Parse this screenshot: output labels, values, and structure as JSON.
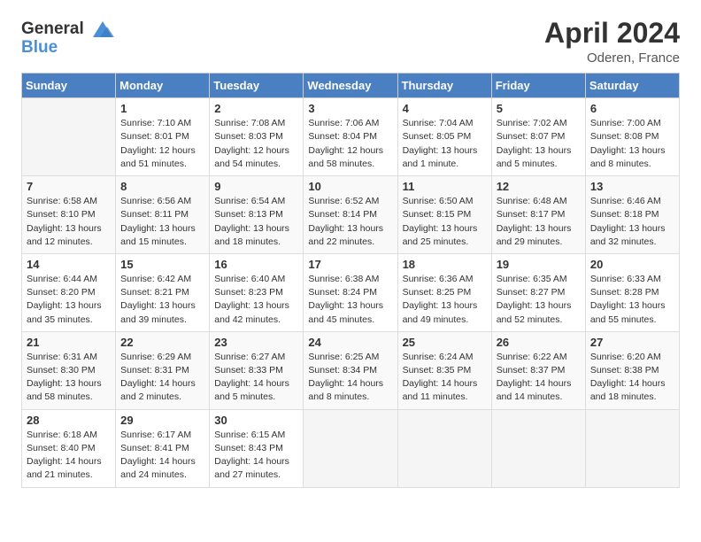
{
  "header": {
    "logo_line1": "General",
    "logo_line2": "Blue",
    "title": "April 2024",
    "subtitle": "Oderen, France"
  },
  "days_of_week": [
    "Sunday",
    "Monday",
    "Tuesday",
    "Wednesday",
    "Thursday",
    "Friday",
    "Saturday"
  ],
  "weeks": [
    [
      {
        "num": "",
        "info": ""
      },
      {
        "num": "1",
        "info": "Sunrise: 7:10 AM\nSunset: 8:01 PM\nDaylight: 12 hours\nand 51 minutes."
      },
      {
        "num": "2",
        "info": "Sunrise: 7:08 AM\nSunset: 8:03 PM\nDaylight: 12 hours\nand 54 minutes."
      },
      {
        "num": "3",
        "info": "Sunrise: 7:06 AM\nSunset: 8:04 PM\nDaylight: 12 hours\nand 58 minutes."
      },
      {
        "num": "4",
        "info": "Sunrise: 7:04 AM\nSunset: 8:05 PM\nDaylight: 13 hours\nand 1 minute."
      },
      {
        "num": "5",
        "info": "Sunrise: 7:02 AM\nSunset: 8:07 PM\nDaylight: 13 hours\nand 5 minutes."
      },
      {
        "num": "6",
        "info": "Sunrise: 7:00 AM\nSunset: 8:08 PM\nDaylight: 13 hours\nand 8 minutes."
      }
    ],
    [
      {
        "num": "7",
        "info": "Sunrise: 6:58 AM\nSunset: 8:10 PM\nDaylight: 13 hours\nand 12 minutes."
      },
      {
        "num": "8",
        "info": "Sunrise: 6:56 AM\nSunset: 8:11 PM\nDaylight: 13 hours\nand 15 minutes."
      },
      {
        "num": "9",
        "info": "Sunrise: 6:54 AM\nSunset: 8:13 PM\nDaylight: 13 hours\nand 18 minutes."
      },
      {
        "num": "10",
        "info": "Sunrise: 6:52 AM\nSunset: 8:14 PM\nDaylight: 13 hours\nand 22 minutes."
      },
      {
        "num": "11",
        "info": "Sunrise: 6:50 AM\nSunset: 8:15 PM\nDaylight: 13 hours\nand 25 minutes."
      },
      {
        "num": "12",
        "info": "Sunrise: 6:48 AM\nSunset: 8:17 PM\nDaylight: 13 hours\nand 29 minutes."
      },
      {
        "num": "13",
        "info": "Sunrise: 6:46 AM\nSunset: 8:18 PM\nDaylight: 13 hours\nand 32 minutes."
      }
    ],
    [
      {
        "num": "14",
        "info": "Sunrise: 6:44 AM\nSunset: 8:20 PM\nDaylight: 13 hours\nand 35 minutes."
      },
      {
        "num": "15",
        "info": "Sunrise: 6:42 AM\nSunset: 8:21 PM\nDaylight: 13 hours\nand 39 minutes."
      },
      {
        "num": "16",
        "info": "Sunrise: 6:40 AM\nSunset: 8:23 PM\nDaylight: 13 hours\nand 42 minutes."
      },
      {
        "num": "17",
        "info": "Sunrise: 6:38 AM\nSunset: 8:24 PM\nDaylight: 13 hours\nand 45 minutes."
      },
      {
        "num": "18",
        "info": "Sunrise: 6:36 AM\nSunset: 8:25 PM\nDaylight: 13 hours\nand 49 minutes."
      },
      {
        "num": "19",
        "info": "Sunrise: 6:35 AM\nSunset: 8:27 PM\nDaylight: 13 hours\nand 52 minutes."
      },
      {
        "num": "20",
        "info": "Sunrise: 6:33 AM\nSunset: 8:28 PM\nDaylight: 13 hours\nand 55 minutes."
      }
    ],
    [
      {
        "num": "21",
        "info": "Sunrise: 6:31 AM\nSunset: 8:30 PM\nDaylight: 13 hours\nand 58 minutes."
      },
      {
        "num": "22",
        "info": "Sunrise: 6:29 AM\nSunset: 8:31 PM\nDaylight: 14 hours\nand 2 minutes."
      },
      {
        "num": "23",
        "info": "Sunrise: 6:27 AM\nSunset: 8:33 PM\nDaylight: 14 hours\nand 5 minutes."
      },
      {
        "num": "24",
        "info": "Sunrise: 6:25 AM\nSunset: 8:34 PM\nDaylight: 14 hours\nand 8 minutes."
      },
      {
        "num": "25",
        "info": "Sunrise: 6:24 AM\nSunset: 8:35 PM\nDaylight: 14 hours\nand 11 minutes."
      },
      {
        "num": "26",
        "info": "Sunrise: 6:22 AM\nSunset: 8:37 PM\nDaylight: 14 hours\nand 14 minutes."
      },
      {
        "num": "27",
        "info": "Sunrise: 6:20 AM\nSunset: 8:38 PM\nDaylight: 14 hours\nand 18 minutes."
      }
    ],
    [
      {
        "num": "28",
        "info": "Sunrise: 6:18 AM\nSunset: 8:40 PM\nDaylight: 14 hours\nand 21 minutes."
      },
      {
        "num": "29",
        "info": "Sunrise: 6:17 AM\nSunset: 8:41 PM\nDaylight: 14 hours\nand 24 minutes."
      },
      {
        "num": "30",
        "info": "Sunrise: 6:15 AM\nSunset: 8:43 PM\nDaylight: 14 hours\nand 27 minutes."
      },
      {
        "num": "",
        "info": ""
      },
      {
        "num": "",
        "info": ""
      },
      {
        "num": "",
        "info": ""
      },
      {
        "num": "",
        "info": ""
      }
    ]
  ]
}
